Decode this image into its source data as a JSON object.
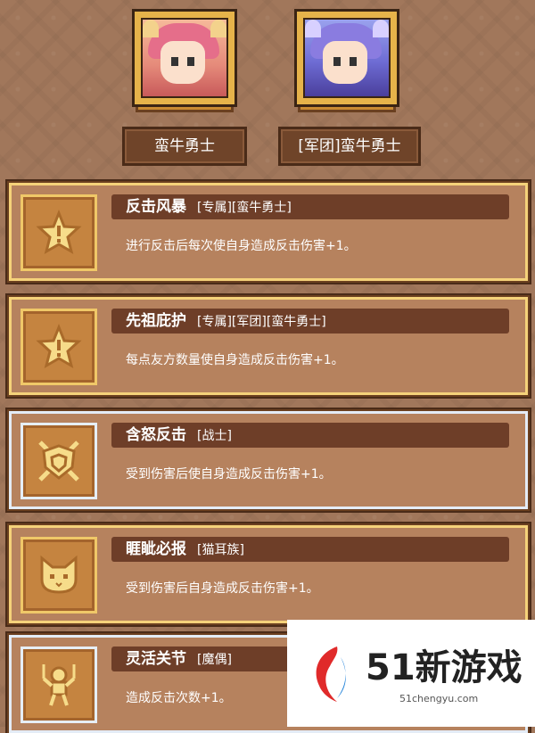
{
  "heroes": [
    {
      "name": "蛮牛勇士"
    },
    {
      "name": "[军团]蛮牛勇士"
    }
  ],
  "bonds": [
    {
      "title": "反击风暴",
      "tags": "[专属][蛮牛勇士]",
      "description": "进行反击后每次使自身造成反击伤害+1。",
      "icon": "star-icon",
      "frame": "gold"
    },
    {
      "title": "先祖庇护",
      "tags": "[专属][军团][蛮牛勇士]",
      "description": "每点友方数量使自身造成反击伤害+1。",
      "icon": "star-icon",
      "frame": "gold"
    },
    {
      "title": "含怒反击",
      "tags": "[战士]",
      "description": "受到伤害后使自身造成反击伤害+1。",
      "icon": "shield-swords-icon",
      "frame": "silver"
    },
    {
      "title": "睚眦必报",
      "tags": "[猫耳族]",
      "description": "受到伤害后自身造成反击伤害+1。",
      "icon": "cat-face-icon",
      "frame": "gold"
    },
    {
      "title": "灵活关节",
      "tags": "[魔偶]",
      "description": "造成反击次数+1。",
      "icon": "puppet-icon",
      "frame": "silver"
    }
  ],
  "watermark": {
    "brand": "51新游戏",
    "url": "51chengyu.com"
  }
}
